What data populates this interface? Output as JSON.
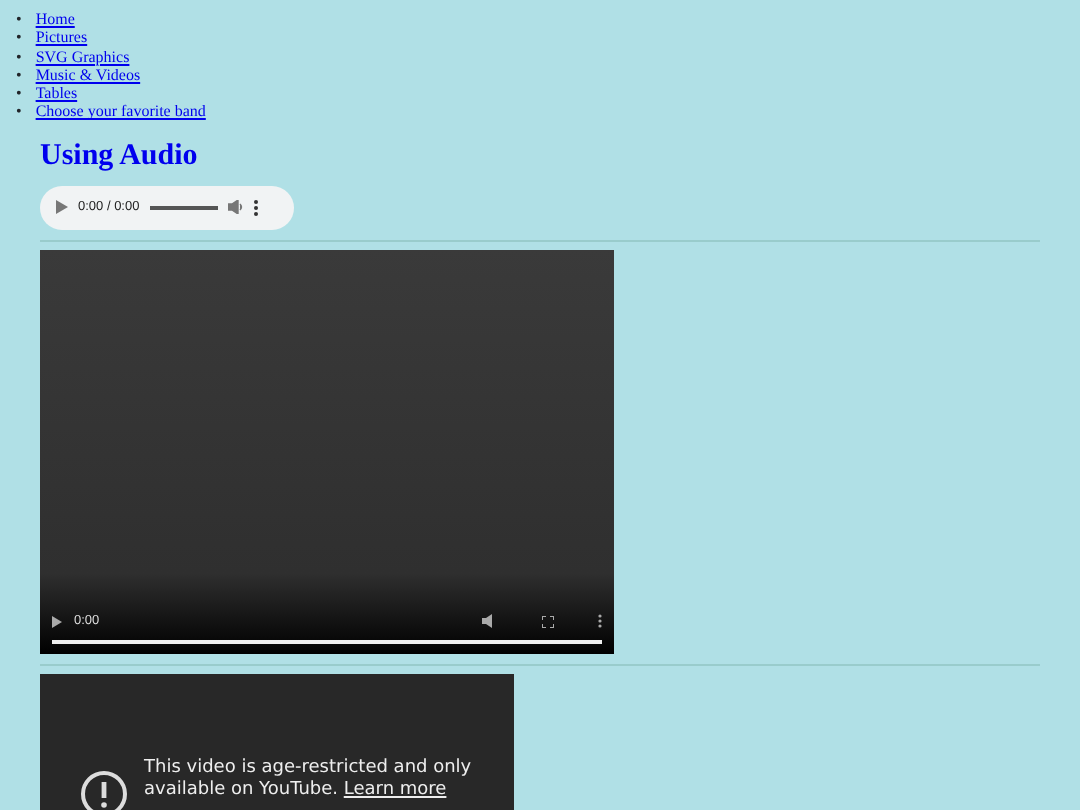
{
  "nav": [
    {
      "marker": "•",
      "label": "Home"
    },
    {
      "marker": "•",
      "label": "Pictures"
    },
    {
      "marker": "•",
      "label": "SVG Graphics"
    },
    {
      "marker": "•",
      "label": "Music & Videos"
    },
    {
      "marker": "•",
      "label": "Tables"
    },
    {
      "marker": "•",
      "label": "Choose your favorite band"
    }
  ],
  "heading": "Using Audio",
  "audio": {
    "time": "0:00 / 0:00"
  },
  "video": {
    "time": "0:00"
  },
  "embed": {
    "message": "This video is age-restricted and only available on YouTube.",
    "link": "Learn more"
  }
}
